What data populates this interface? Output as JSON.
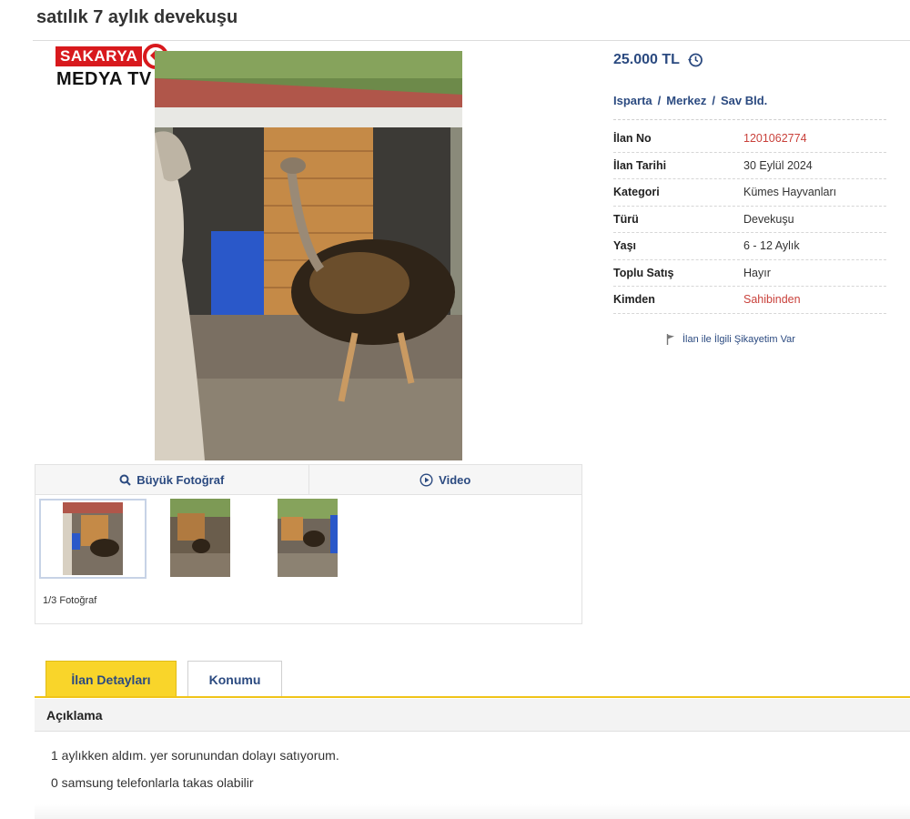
{
  "listing": {
    "title": "satılık 7 aylık devekuşu",
    "price": "25.000 TL",
    "location": {
      "city": "Isparta",
      "district": "Merkez",
      "neighborhood": "Sav Bld."
    }
  },
  "logo": {
    "top": "SAKARYA",
    "bottom": "MEDYA TV"
  },
  "details": [
    {
      "label": "İlan No",
      "value": "1201062774",
      "highlight": true
    },
    {
      "label": "İlan Tarihi",
      "value": "30 Eylül 2024",
      "highlight": false
    },
    {
      "label": "Kategori",
      "value": "Kümes Hayvanları",
      "highlight": false
    },
    {
      "label": "Türü",
      "value": "Devekuşu",
      "highlight": false
    },
    {
      "label": "Yaşı",
      "value": "6 - 12 Aylık",
      "highlight": false
    },
    {
      "label": "Toplu Satış",
      "value": "Hayır",
      "highlight": false
    },
    {
      "label": "Kimden",
      "value": "Sahibinden",
      "highlight": true
    }
  ],
  "complaint_link": "İlan ile İlgili Şikayetim Var",
  "gallery": {
    "big_photo_label": "Büyük Fotoğraf",
    "video_label": "Video",
    "counter": "1/3 Fotoğraf"
  },
  "tabs": {
    "details": "İlan Detayları",
    "location": "Konumu"
  },
  "description": {
    "heading": "Açıklama",
    "lines": [
      "1 aylıkken aldım. yer sorunundan dolayı satıyorum.",
      "0 samsung telefonlarla takas olabilir"
    ]
  },
  "colors": {
    "link": "#2b4a80",
    "accent_tab": "#f9d52a",
    "highlight_text": "#c9413b",
    "logo_red": "#d8191d"
  }
}
